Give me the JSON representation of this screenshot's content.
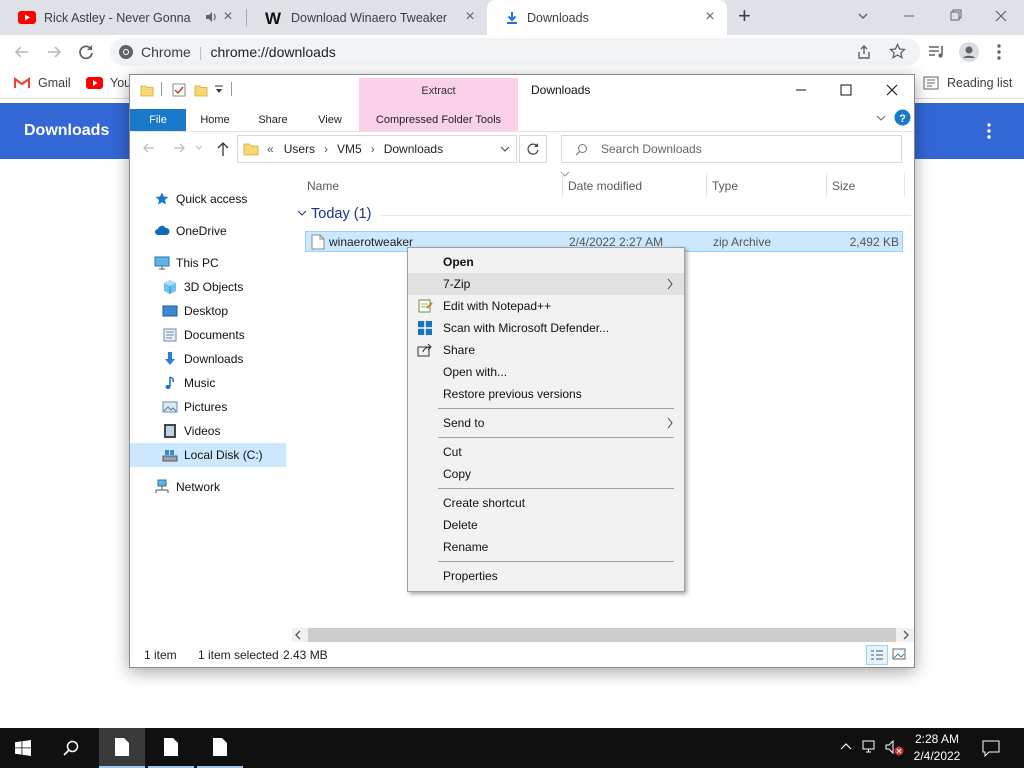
{
  "browser": {
    "tabs": [
      {
        "title": "Rick Astley - Never Gonna G",
        "icon": "youtube-icon",
        "active": false
      },
      {
        "title": "Download Winaero Tweaker",
        "icon": "winaero-w-icon",
        "active": false
      },
      {
        "title": "Downloads",
        "icon": "download-icon",
        "active": true
      }
    ],
    "new_tab": "+",
    "omnibox": {
      "site": "Chrome",
      "url": "chrome://downloads"
    },
    "bookmarks": [
      {
        "label": "Gmail",
        "icon": "gmail-icon"
      },
      {
        "label": "You",
        "icon": "youtube-icon"
      }
    ],
    "reading_list": "Reading list",
    "downloads_title": "Downloads",
    "colors": {
      "tabstrip": "#dee1e6",
      "header": "#3367d6"
    }
  },
  "explorer": {
    "ribbon": {
      "contextual_group": "Extract",
      "contextual_tab": "Compressed Folder Tools",
      "window_title": "Downloads",
      "tabs": [
        "File",
        "Home",
        "Share",
        "View"
      ]
    },
    "breadcrumb": {
      "prefix": "«",
      "parts": [
        "Users",
        "VM5",
        "Downloads"
      ]
    },
    "search_placeholder": "Search Downloads",
    "columns": [
      "Name",
      "Date modified",
      "Type",
      "Size"
    ],
    "group": "Today (1)",
    "file": {
      "name": "winaerotweaker",
      "date": "2/4/2022 2:27 AM",
      "type": "zip Archive",
      "size": "2,492 KB"
    },
    "nav": [
      {
        "label": "Quick access",
        "icon": "star-icon"
      },
      {
        "label": "OneDrive",
        "icon": "cloud-icon"
      },
      {
        "label": "This PC",
        "icon": "monitor-icon"
      },
      {
        "label": "3D Objects",
        "icon": "cube-icon"
      },
      {
        "label": "Desktop",
        "icon": "desktop-icon"
      },
      {
        "label": "Documents",
        "icon": "documents-icon"
      },
      {
        "label": "Downloads",
        "icon": "download-arrow-icon"
      },
      {
        "label": "Music",
        "icon": "music-icon"
      },
      {
        "label": "Pictures",
        "icon": "pictures-icon"
      },
      {
        "label": "Videos",
        "icon": "videos-icon"
      },
      {
        "label": "Local Disk (C:)",
        "icon": "drive-icon"
      },
      {
        "label": "Network",
        "icon": "network-icon"
      }
    ],
    "status": {
      "count": "1 item",
      "selected": "1 item selected",
      "size": "2.43 MB"
    }
  },
  "context_menu": {
    "items": [
      {
        "label": "Open"
      },
      {
        "label": "7-Zip"
      },
      {
        "label": "Edit with Notepad++"
      },
      {
        "label": "Scan with Microsoft Defender..."
      },
      {
        "label": "Share"
      },
      {
        "label": "Open with..."
      },
      {
        "label": "Restore previous versions"
      },
      {
        "label": "Send to"
      },
      {
        "label": "Cut"
      },
      {
        "label": "Copy"
      },
      {
        "label": "Create shortcut"
      },
      {
        "label": "Delete"
      },
      {
        "label": "Rename"
      },
      {
        "label": "Properties"
      }
    ]
  },
  "taskbar": {
    "time": "2:28 AM",
    "date": "2/4/2022"
  }
}
